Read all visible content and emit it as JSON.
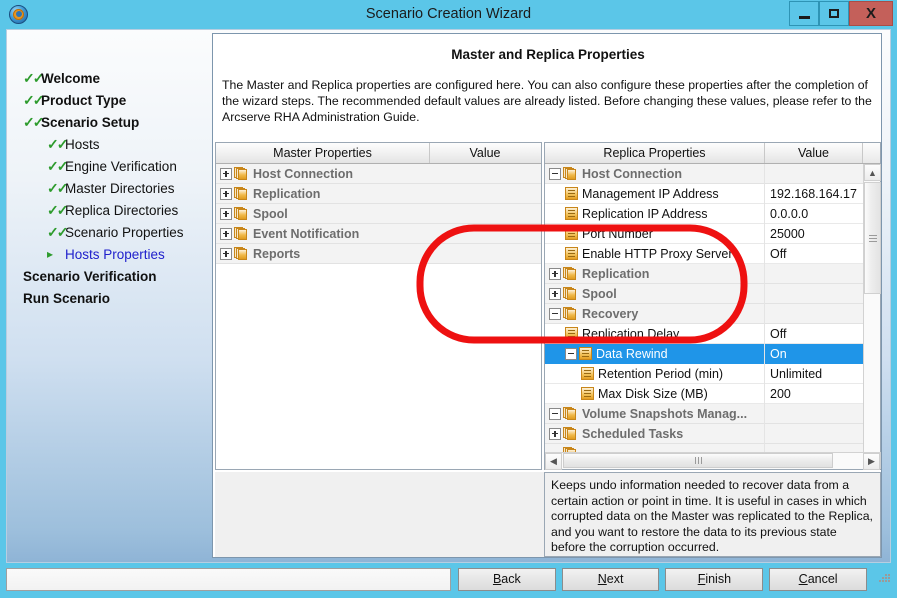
{
  "window": {
    "title": "Scenario Creation Wizard",
    "icon": "arcserve-app-icon",
    "controls": {
      "minimize": "minimize-icon",
      "maximize": "maximize-icon",
      "close": "X"
    },
    "accent_color": "#5bc6e8",
    "close_color": "#c4605a"
  },
  "sidebar": {
    "items": [
      {
        "label": "Welcome",
        "level": 1,
        "state": "done",
        "marker": "check"
      },
      {
        "label": "Product Type",
        "level": 1,
        "state": "done",
        "marker": "check"
      },
      {
        "label": "Scenario Setup",
        "level": 1,
        "state": "done",
        "marker": "check"
      },
      {
        "label": "Hosts",
        "level": 2,
        "state": "done",
        "marker": "check"
      },
      {
        "label": "Engine Verification",
        "level": 2,
        "state": "done",
        "marker": "check"
      },
      {
        "label": "Master Directories",
        "level": 2,
        "state": "done",
        "marker": "check"
      },
      {
        "label": "Replica Directories",
        "level": 2,
        "state": "done",
        "marker": "check"
      },
      {
        "label": "Scenario Properties",
        "level": 2,
        "state": "done",
        "marker": "check"
      },
      {
        "label": "Hosts Properties",
        "level": 2,
        "state": "current",
        "marker": "arrow"
      },
      {
        "label": "Scenario Verification",
        "level": 1,
        "state": "pending",
        "marker": "none"
      },
      {
        "label": "Run Scenario",
        "level": 1,
        "state": "pending",
        "marker": "none"
      }
    ],
    "check_color": "#2d9b2d",
    "current_color": "#2020cc"
  },
  "main": {
    "title": "Master and Replica Properties",
    "description": "The Master and Replica properties are configured here. You can also configure these properties after the completion of the wizard steps. The recommended default values are already listed. Before changing these values, please refer to the Arcserve RHA Administration Guide."
  },
  "master_tree": {
    "headers": {
      "name": "Master Properties",
      "value": "Value"
    },
    "rows": [
      {
        "label": "Host Connection",
        "value": "",
        "indent": 0,
        "type": "group",
        "expander": "plus",
        "icon": "property-group-icon"
      },
      {
        "label": "Replication",
        "value": "",
        "indent": 0,
        "type": "group",
        "expander": "plus",
        "icon": "property-group-icon"
      },
      {
        "label": "Spool",
        "value": "",
        "indent": 0,
        "type": "group",
        "expander": "plus",
        "icon": "property-group-icon"
      },
      {
        "label": "Event Notification",
        "value": "",
        "indent": 0,
        "type": "group",
        "expander": "plus",
        "icon": "property-group-icon"
      },
      {
        "label": "Reports",
        "value": "",
        "indent": 0,
        "type": "group",
        "expander": "plus",
        "icon": "property-group-icon"
      }
    ]
  },
  "replica_tree": {
    "headers": {
      "name": "Replica Properties",
      "value": "Value"
    },
    "rows": [
      {
        "label": "Host Connection",
        "value": "",
        "indent": 0,
        "type": "group",
        "expander": "minus",
        "icon": "property-group-icon",
        "selected": false
      },
      {
        "label": "Management IP Address",
        "value": "192.168.164.17",
        "indent": 1,
        "type": "leaf",
        "expander": "none",
        "icon": "property-leaf-icon",
        "selected": false
      },
      {
        "label": "Replication IP Address",
        "value": "0.0.0.0",
        "indent": 1,
        "type": "leaf",
        "expander": "none",
        "icon": "property-leaf-icon",
        "selected": false
      },
      {
        "label": "Port Number",
        "value": "25000",
        "indent": 1,
        "type": "leaf",
        "expander": "none",
        "icon": "property-leaf-icon",
        "selected": false
      },
      {
        "label": "Enable HTTP Proxy Server",
        "value": "Off",
        "indent": 1,
        "type": "leaf",
        "expander": "none",
        "icon": "property-leaf-icon",
        "selected": false
      },
      {
        "label": "Replication",
        "value": "",
        "indent": 0,
        "type": "group",
        "expander": "plus",
        "icon": "property-group-icon",
        "selected": false
      },
      {
        "label": "Spool",
        "value": "",
        "indent": 0,
        "type": "group",
        "expander": "plus",
        "icon": "property-group-icon",
        "selected": false
      },
      {
        "label": "Recovery",
        "value": "",
        "indent": 0,
        "type": "group",
        "expander": "minus",
        "icon": "property-group-icon",
        "selected": false
      },
      {
        "label": "Replication Delay",
        "value": "Off",
        "indent": 1,
        "type": "leaf",
        "expander": "none",
        "icon": "property-leaf-icon",
        "selected": false
      },
      {
        "label": "Data Rewind",
        "value": "On",
        "indent": 1,
        "type": "leaf",
        "expander": "minus",
        "icon": "property-leaf-icon",
        "selected": true
      },
      {
        "label": "Retention Period (min)",
        "value": "Unlimited",
        "indent": 2,
        "type": "leaf",
        "expander": "none",
        "icon": "property-leaf-icon",
        "selected": false
      },
      {
        "label": "Max Disk Size (MB)",
        "value": "200",
        "indent": 2,
        "type": "leaf",
        "expander": "none",
        "icon": "property-leaf-icon",
        "selected": false
      },
      {
        "label": "Volume Snapshots Manag...",
        "value": "",
        "indent": 0,
        "type": "group",
        "expander": "minus",
        "icon": "property-group-icon",
        "selected": false
      },
      {
        "label": "Scheduled Tasks",
        "value": "",
        "indent": 0,
        "type": "group",
        "expander": "plus",
        "icon": "property-group-icon",
        "selected": false
      }
    ],
    "selected_row_color": "#1f95e8"
  },
  "annotation": {
    "shape": "red-oval-highlight",
    "color": "#ee1111",
    "targets": [
      "Recovery",
      "Replication Delay",
      "Data Rewind",
      "Retention Period (min)",
      "Max Disk Size (MB)"
    ]
  },
  "description_pane": {
    "text": "Keeps undo information needed to recover data from a certain action or point in time. It is useful in cases in which corrupted data on the Master was replicated to the Replica, and you want to restore the data to its previous state before the corruption occurred."
  },
  "footer": {
    "status": "",
    "buttons": [
      {
        "label": "Back",
        "mnemonic": "B"
      },
      {
        "label": "Next",
        "mnemonic": "N"
      },
      {
        "label": "Finish",
        "mnemonic": "F"
      },
      {
        "label": "Cancel",
        "mnemonic": "C"
      }
    ]
  },
  "scrollbars": {
    "vertical": {
      "up": "chevron-up-icon",
      "down": "chevron-down-icon"
    },
    "horizontal": {
      "left": "chevron-left-icon",
      "right": "chevron-right-icon"
    }
  }
}
